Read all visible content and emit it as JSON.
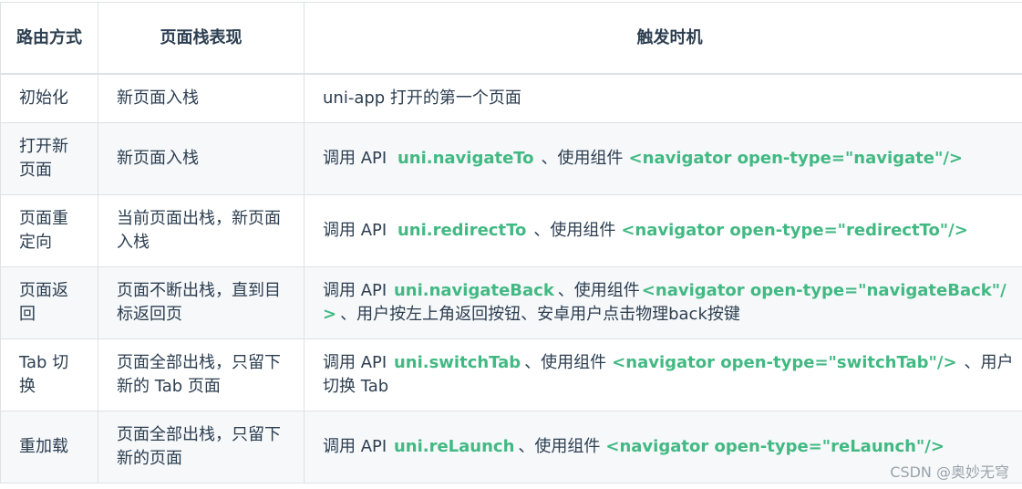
{
  "headers": [
    "路由方式",
    "页面栈表现",
    "触发时机"
  ],
  "rows": [
    {
      "method": "初始化",
      "stack": "新页面入栈",
      "trigger": {
        "text1": "uni-app 打开的第一个页面"
      }
    },
    {
      "method": "打开新页面",
      "stack": "新页面入栈",
      "trigger": {
        "prefix": "调用 API",
        "api": "uni.navigateTo",
        "mid": "、使用组件",
        "component": "<navigator open-type=\"navigate\"/>"
      }
    },
    {
      "method": "页面重定向",
      "stack": "当前页面出栈，新页面入栈",
      "trigger": {
        "prefix": "调用 API",
        "api": "uni.redirectTo",
        "mid": "、使用组件",
        "component": "<navigator open-type=\"redirectTo\"/>"
      }
    },
    {
      "method": "页面返回",
      "stack": "页面不断出栈，直到目标返回页",
      "trigger": {
        "prefix": "调用 API",
        "api": "uni.navigateBack",
        "mid": "、使用组件",
        "component": "<navigator open-type=\"navigateBack\"/>",
        "suffix": "、用户按左上角返回按钮、安卓用户点击物理back按键"
      }
    },
    {
      "method": "Tab 切换",
      "stack": "页面全部出栈，只留下新的 Tab 页面",
      "trigger": {
        "prefix": "调用 API",
        "api": "uni.switchTab",
        "mid": "、使用组件",
        "component": "<navigator open-type=\"switchTab\"/>",
        "suffix": "、用户切换 Tab"
      }
    },
    {
      "method": "重加载",
      "stack": "页面全部出栈，只留下新的页面",
      "trigger": {
        "prefix": "调用 API",
        "api": "uni.reLaunch",
        "mid": "、使用组件",
        "component": "<navigator open-type=\"reLaunch\"/>"
      }
    }
  ],
  "watermark": "CSDN @奥妙无穹",
  "colors": {
    "code": "#42b983",
    "border": "#dfe2e5",
    "alt_row": "#f6f8fa",
    "text": "#2c3e50"
  }
}
